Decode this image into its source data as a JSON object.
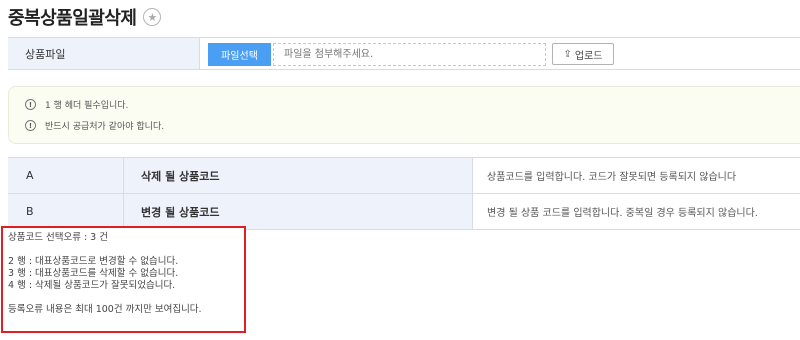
{
  "page": {
    "title": "중복상품일괄삭제"
  },
  "upload": {
    "label": "상품파일",
    "file_select_label": "파일선택",
    "file_placeholder": "파일을 첨부해주세요.",
    "upload_label": "업로드"
  },
  "notices": [
    {
      "text": "1 행 헤더 필수입니다."
    },
    {
      "text": "반드시 공급처가 같아야 합니다."
    }
  ],
  "mapping": [
    {
      "column": "A",
      "field": "삭제 될 상품코드",
      "description": "상품코드를 입력합니다. 코드가 잘못되면 등록되지 않습니다"
    },
    {
      "column": "B",
      "field": "변경 될 상품코드",
      "description": "변경 될 상품 코드를 입력합니다. 중복일 경우 등록되지 않습니다."
    }
  ],
  "errors": {
    "summary": "상품코드 선택오류 : 3 건",
    "items": [
      "2 행 : 대표상품코드로 변경할 수 없습니다.",
      "3 행 : 대표상품코드를 삭제할 수 없습니다.",
      "4 행 : 삭제될 상품코드가 잘못되었습니다."
    ],
    "footer": "등록오류 내용은 최대 100건 까지만 보여집니다."
  },
  "colors": {
    "accent": "#4a9ff5",
    "header_bg": "#eef3fb",
    "notice_bg": "#fbfcf2",
    "error_border": "#e02020"
  },
  "icons": {
    "favorite": "star-icon",
    "notice": "exclamation-circle-icon",
    "upload": "upload-icon"
  }
}
